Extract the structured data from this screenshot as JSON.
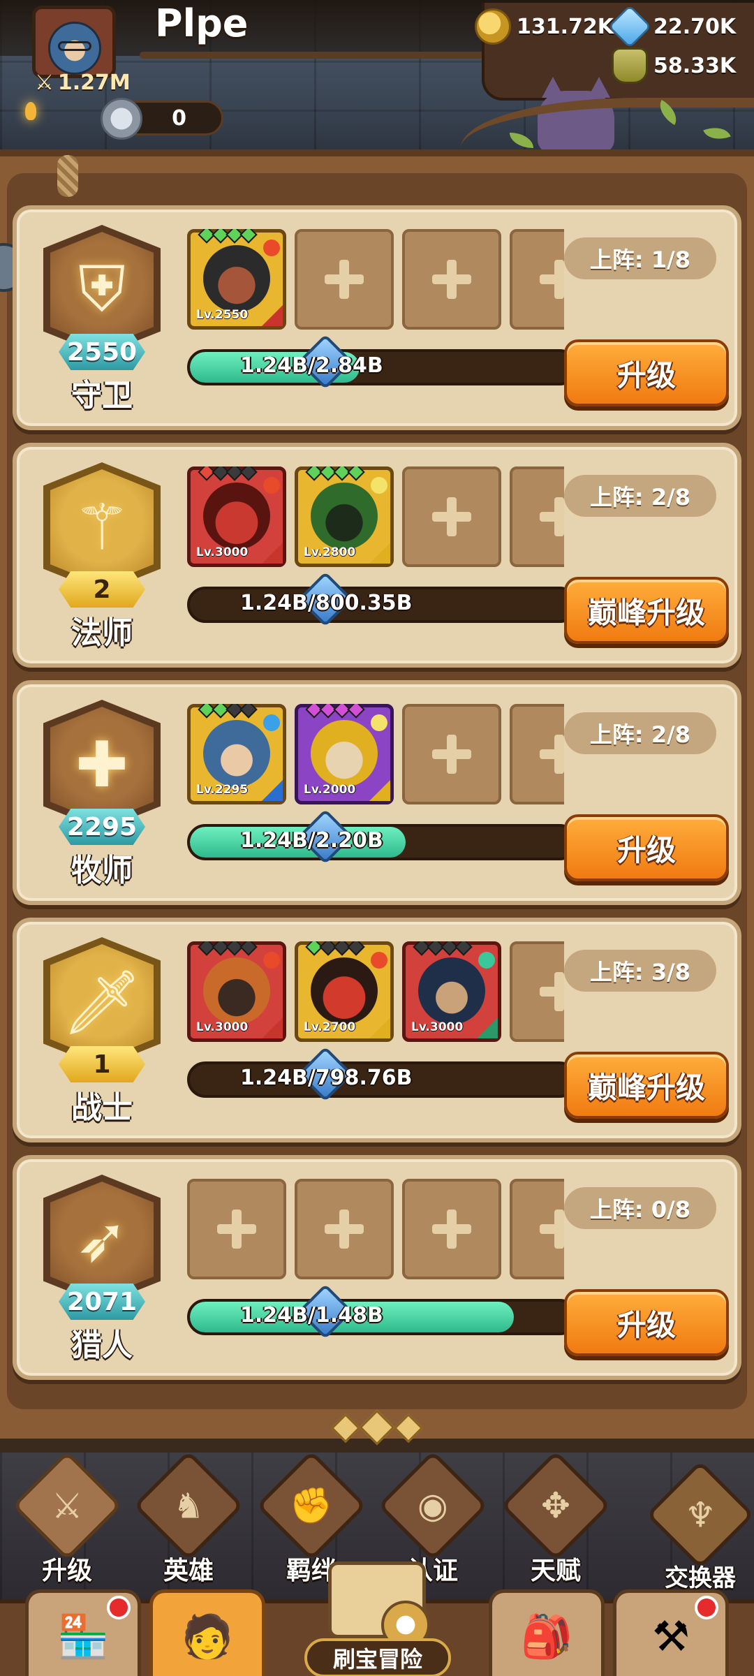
{
  "player": {
    "name": "Plpe",
    "power": "1.27M",
    "tokens": "0"
  },
  "currencies": {
    "gold": "131.72K",
    "gems": "22.70K",
    "potions": "58.33K"
  },
  "classes": [
    {
      "name": "守卫",
      "level": "2550",
      "badge_style": "teal",
      "deployed": "上阵: 1/8",
      "progress_text": "1.24B/2.84B",
      "progress": 0.44,
      "button": "升级",
      "heroes": [
        {
          "level": "Lv.2550",
          "frame": "yellow",
          "stars": 4,
          "star_color": "green"
        }
      ]
    },
    {
      "name": "法师",
      "level": "2",
      "badge_style": "yellow",
      "deployed": "上阵: 2/8",
      "progress_text": "1.24B/800.35B",
      "progress": 0.0,
      "button": "巅峰升级",
      "heroes": [
        {
          "level": "Lv.3000",
          "frame": "red",
          "stars": 1,
          "star_color": "red"
        },
        {
          "level": "Lv.2800",
          "frame": "yellow",
          "stars": 4,
          "star_color": "green"
        }
      ]
    },
    {
      "name": "牧师",
      "level": "2295",
      "badge_style": "teal",
      "deployed": "上阵: 2/8",
      "progress_text": "1.24B/2.20B",
      "progress": 0.56,
      "button": "升级",
      "heroes": [
        {
          "level": "Lv.2295",
          "frame": "yellow",
          "stars": 2,
          "star_color": "green"
        },
        {
          "level": "Lv.2000",
          "frame": "purple",
          "stars": 4,
          "star_color": "pink"
        }
      ]
    },
    {
      "name": "战士",
      "level": "1",
      "badge_style": "yellow",
      "deployed": "上阵: 3/8",
      "progress_text": "1.24B/798.76B",
      "progress": 0.0,
      "button": "巅峰升级",
      "heroes": [
        {
          "level": "Lv.3000",
          "frame": "red",
          "stars": 0,
          "star_color": "green"
        },
        {
          "level": "Lv.2700",
          "frame": "yellow",
          "stars": 1,
          "star_color": "green"
        },
        {
          "level": "Lv.3000",
          "frame": "red",
          "stars": 0,
          "star_color": "green"
        }
      ]
    },
    {
      "name": "猎人",
      "level": "2071",
      "badge_style": "teal",
      "deployed": "上阵: 0/8",
      "progress_text": "1.24B/1.48B",
      "progress": 0.84,
      "button": "升级",
      "heroes": []
    }
  ],
  "function_bar": [
    {
      "label": "升级",
      "icon": "sword-icon",
      "active": true
    },
    {
      "label": "英雄",
      "icon": "hero-icon",
      "active": false
    },
    {
      "label": "羁绊",
      "icon": "fist-icon",
      "active": false
    },
    {
      "label": "认证",
      "icon": "eye-icon",
      "active": false
    },
    {
      "label": "天赋",
      "icon": "talent-icon",
      "active": false
    }
  ],
  "exchanger": {
    "label": "交换器",
    "icon": "exchanger-icon"
  },
  "bottom_nav": {
    "center_label": "刷宝冒险",
    "items": [
      {
        "icon": "shop-icon",
        "badge": true,
        "active": false
      },
      {
        "icon": "heroes-icon",
        "badge": false,
        "active": true
      },
      {
        "icon": "bag-icon",
        "badge": false,
        "active": false
      },
      {
        "icon": "forge-icon",
        "badge": true,
        "active": false
      }
    ]
  },
  "colors": {
    "accent_orange": "#f07b12",
    "progress_green": "#2fb98c",
    "badge_teal": "#2e9aa3",
    "badge_yellow": "#e0a81e",
    "notification_red": "#e52b2b"
  }
}
